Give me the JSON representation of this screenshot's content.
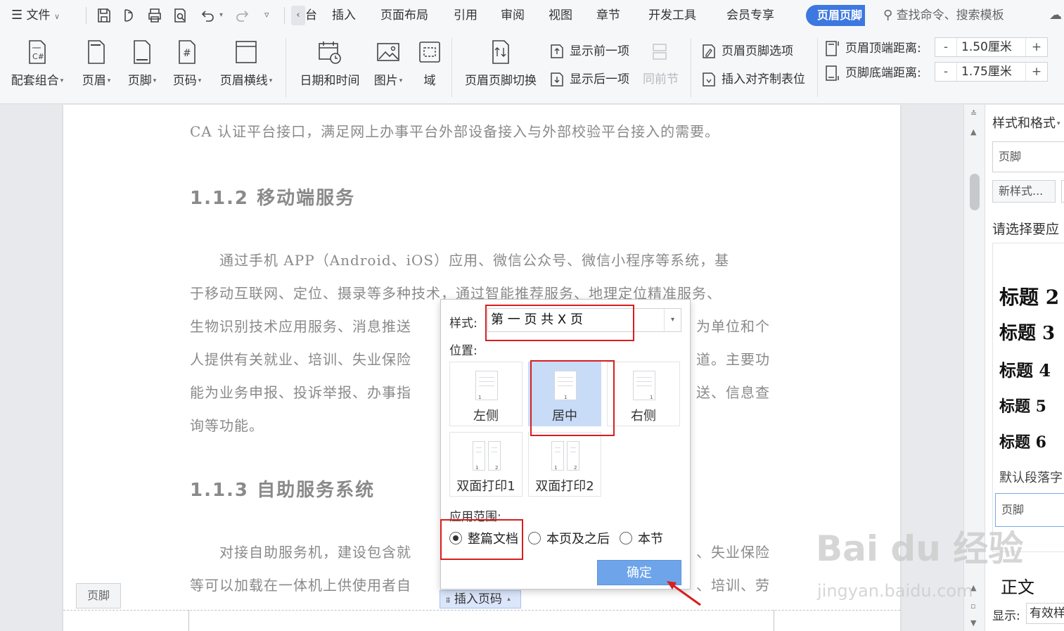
{
  "menubar": {
    "file_label": "文件",
    "tabs": [
      "插入",
      "页面布局",
      "引用",
      "审阅",
      "视图",
      "章节",
      "开发工具",
      "会员专享"
    ],
    "partial_tab": "台",
    "active_tab": "页眉页脚",
    "search_placeholder": "查找命令、搜索模板"
  },
  "ribbon": {
    "big_buttons": [
      {
        "label": "配套组合",
        "icon": "combo-icon"
      },
      {
        "label": "页眉",
        "icon": "header-icon"
      },
      {
        "label": "页脚",
        "icon": "footer-icon"
      },
      {
        "label": "页码",
        "icon": "page-number-icon"
      },
      {
        "label": "页眉横线",
        "icon": "header-line-icon"
      },
      {
        "label": "日期和时间",
        "icon": "date-time-icon"
      },
      {
        "label": "图片",
        "icon": "picture-icon"
      },
      {
        "label": "域",
        "icon": "field-icon"
      },
      {
        "label": "页眉页脚切换",
        "icon": "switch-icon"
      }
    ],
    "show_prev": "显示前一项",
    "show_next": "显示后一项",
    "same_as_prev": "同前节",
    "hf_options": "页眉页脚选项",
    "insert_align_tab": "插入对齐制表位",
    "header_top_label": "页眉顶端距离:",
    "header_top_value": "1.50厘米",
    "footer_bottom_label": "页脚底端距离:",
    "footer_bottom_value": "1.75厘米",
    "minus": "-",
    "plus": "+"
  },
  "document": {
    "line1": "CA 认证平台接口，满足网上办事平台外部设备接入与外部校验平台接入的需要。",
    "heading1": "1.1.2 移动端服务",
    "p1_lines": [
      "　　通过手机 APP（Android、iOS）应用、微信公众号、微信小程序等系统，基",
      "于移动互联网、定位、摄录等多种技术，通过智能推荐服务、地理定位精准服务、",
      "生物识别技术应用服务、消息推送",
      "人提供有关就业、培训、失业保险",
      "能为业务申报、投诉举报、办事指",
      "询等功能。"
    ],
    "p1_right": [
      "为单位和个",
      "道。主要功",
      "送、信息查"
    ],
    "heading2": "1.1.3 自助服务系统",
    "p2_lines": [
      "　　对接自助服务机，建设包含就",
      "等可以加载在一体机上供使用者自"
    ],
    "p2_right": [
      "、失业保险",
      "、培训、劳"
    ],
    "footer_tag": "页脚",
    "insert_page_number": "插入页码"
  },
  "dialog": {
    "style_label": "样式:",
    "style_value": "第 一 页 共 X 页",
    "position_label": "位置:",
    "positions": [
      {
        "label": "左侧",
        "selected": false
      },
      {
        "label": "居中",
        "selected": true
      },
      {
        "label": "右侧",
        "selected": false
      },
      {
        "label": "双面打印1",
        "selected": false
      },
      {
        "label": "双面打印2",
        "selected": false
      }
    ],
    "scope_label": "应用范围:",
    "scopes": [
      {
        "label": "整篇文档",
        "checked": true
      },
      {
        "label": "本页及之后",
        "checked": false
      },
      {
        "label": "本节",
        "checked": false
      }
    ],
    "ok_label": "确定"
  },
  "rightpanel": {
    "title": "样式和格式",
    "current_style": "页脚",
    "new_style": "新样式...",
    "prompt": "请选择要应",
    "headings": [
      "标题 2",
      "标题 3",
      "标题 4",
      "标题 5",
      "标题 6"
    ],
    "default_font": "默认段落字",
    "selected_style": "页脚",
    "body_style": "正文",
    "show_label": "显示:",
    "show_value": "有效样"
  },
  "watermark": {
    "brand": "Bai du 经验",
    "url": "jingyan.baidu.com"
  },
  "colors": {
    "accent": "#3c78e0",
    "highlight": "#d81e1e",
    "ok_button": "#6da4ea"
  }
}
